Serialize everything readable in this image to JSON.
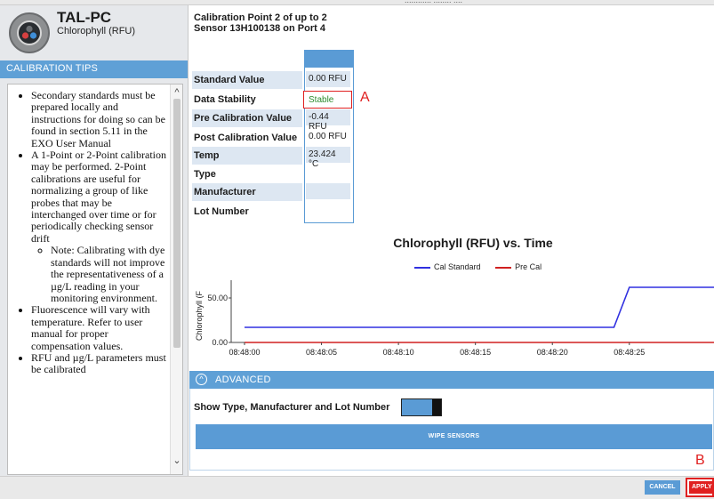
{
  "top_strip": {
    "partial_text": "............ ........ ...."
  },
  "device": {
    "name": "TAL-PC",
    "parameter": "Chlorophyll (RFU)"
  },
  "tips": {
    "header": "CALIBRATION TIPS",
    "items": [
      "Secondary standards must be prepared locally and instructions for doing so can be found in section 5.11 in the EXO User Manual",
      "A 1-Point or 2-Point calibration may be performed. 2-Point calibrations are useful for normalizing a group of like probes that may be interchanged over time or for periodically checking sensor drift",
      "Note: Calibrating with dye standards will not improve the representativeness of a µg/L reading in your monitoring environment.",
      "Fluorescence will vary with temperature. Refer to user manual for proper compensation values.",
      "RFU and µg/L parameters must be calibrated"
    ]
  },
  "header": {
    "calibration_point": "Calibration Point  2  of up to  2",
    "sensor": "Sensor 13H100138 on Port 4"
  },
  "table": {
    "rows": [
      {
        "label": "Standard Value",
        "value": "0.00 RFU"
      },
      {
        "label": "Data Stability",
        "value": "Stable"
      },
      {
        "label": "Pre Calibration Value",
        "value": "-0.44 RFU"
      },
      {
        "label": "Post Calibration Value",
        "value": "0.00 RFU"
      },
      {
        "label": "Temp",
        "value": "23.424 °C"
      },
      {
        "label": "Type",
        "value": ""
      },
      {
        "label": "Manufacturer",
        "value": ""
      },
      {
        "label": "Lot Number",
        "value": ""
      }
    ]
  },
  "annotations": {
    "a": "A",
    "b": "B"
  },
  "colors": {
    "accent": "#5a9bd5",
    "cal_standard": "#3030e0",
    "pre_cal": "#d02020",
    "stable_text": "#2e8b2e",
    "annotation": "#e02020"
  },
  "chart_data": {
    "type": "line",
    "title": "Chlorophyll (RFU) vs. Time",
    "ylabel": "Chlorophyll (F",
    "x_ticks": [
      "08:48:00",
      "08:48:05",
      "08:48:10",
      "08:48:15",
      "08:48:20",
      "08:48:25"
    ],
    "y_ticks": [
      "0.00",
      "50.00"
    ],
    "ylim": [
      0,
      70
    ],
    "xlim": [
      0,
      30.5
    ],
    "grid": false,
    "legend_position": "top-center",
    "series": [
      {
        "name": "Cal Standard",
        "x": [
          0,
          24,
          25,
          30.5
        ],
        "y": [
          17,
          17,
          62,
          62
        ]
      },
      {
        "name": "Pre Cal",
        "x": [
          0,
          30.5
        ],
        "y": [
          0,
          0
        ]
      }
    ]
  },
  "advanced": {
    "label": "ADVANCED",
    "show_label": "Show Type, Manufacturer and Lot Number",
    "wipe_label": "WIPE SENSORS"
  },
  "footer": {
    "cancel_label": "CANCEL",
    "apply_label": "APPLY"
  }
}
